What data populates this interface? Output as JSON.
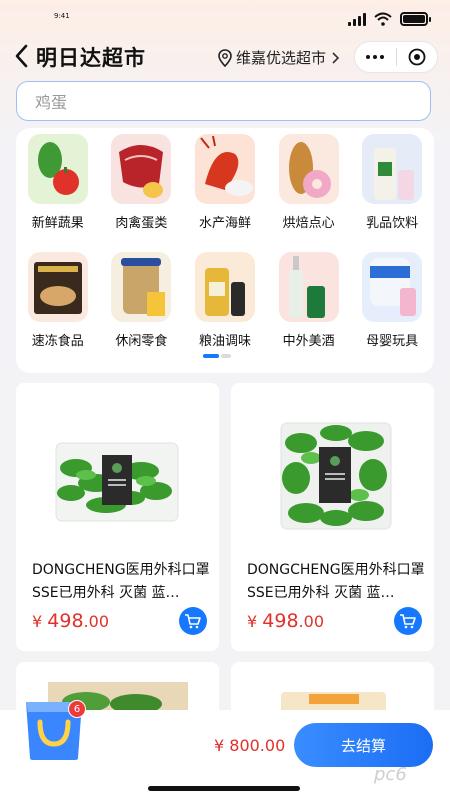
{
  "status_bar": {
    "time": "9:41"
  },
  "nav": {
    "title": "明日达超市",
    "store_name": "维嘉优选超市"
  },
  "search": {
    "placeholder": "鸡蛋"
  },
  "categories": [
    {
      "label": "新鲜蔬果",
      "icon": "vegetables-icon"
    },
    {
      "label": "肉禽蛋类",
      "icon": "meat-icon"
    },
    {
      "label": "水产海鲜",
      "icon": "seafood-icon"
    },
    {
      "label": "烘焙点心",
      "icon": "bakery-icon"
    },
    {
      "label": "乳品饮料",
      "icon": "dairy-icon"
    },
    {
      "label": "速冻食品",
      "icon": "frozen-food-icon"
    },
    {
      "label": "休闲零食",
      "icon": "snacks-icon"
    },
    {
      "label": "粮油调味",
      "icon": "grain-oil-icon"
    },
    {
      "label": "中外美酒",
      "icon": "liquor-icon"
    },
    {
      "label": "母婴玩具",
      "icon": "baby-toys-icon"
    }
  ],
  "products": [
    {
      "name": "DONGCHENG医用外科口罩SSE已用外科 灭菌 蓝…",
      "currency": "¥",
      "price_int": "498",
      "price_dec": ".00"
    },
    {
      "name": "DONGCHENG医用外科口罩SSE已用外科 灭菌 蓝…",
      "currency": "¥",
      "price_int": "498",
      "price_dec": ".00"
    }
  ],
  "cart": {
    "badge_count": "6",
    "total": "¥ 800.00",
    "checkout_label": "去结算"
  },
  "watermark": "pc6",
  "colors": {
    "accent": "#1677ff",
    "price": "#e0312b",
    "badge": "#f0393a"
  }
}
